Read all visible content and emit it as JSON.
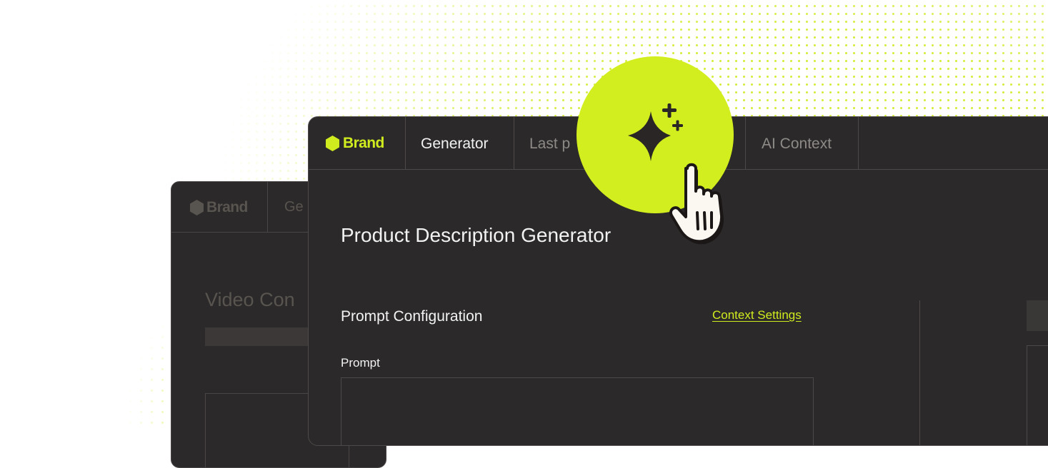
{
  "colors": {
    "accent": "#d0ec1f",
    "window_bg": "#2b2929",
    "border": "#4d4949",
    "text_primary": "#f2f2f2",
    "text_dim": "#8d8a87"
  },
  "back_window": {
    "brand": "Brand",
    "tab_partial": "Ge",
    "title_partial": "Video Con"
  },
  "front_window": {
    "brand": "Brand",
    "tabs": [
      {
        "label": "Generator",
        "active": true
      },
      {
        "label": "Last p",
        "active": false
      },
      {
        "label": "AI Context",
        "active": false
      }
    ],
    "page_title": "Product Description Generator",
    "section_title": "Prompt Configuration",
    "context_link": "Context Settings",
    "prompt_label": "Prompt"
  },
  "icons": {
    "brand": "hexagon-icon",
    "ai_button": "sparkle-icon",
    "cursor": "hand-pointer-icon"
  }
}
